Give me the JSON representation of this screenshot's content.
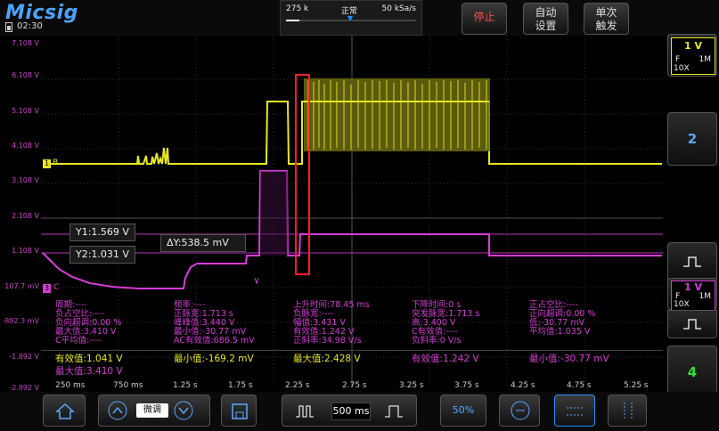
{
  "header": {
    "logo": "Micsig",
    "clock": "02:30",
    "memory_depth": "275 k",
    "trigger_status": "正常",
    "sample_rate": "50 kSa/s",
    "stop_label": "停止",
    "auto_label": [
      "自动",
      "设置"
    ],
    "single_label": [
      "单次",
      "触发"
    ]
  },
  "y_axis_labels": [
    "7.108 V",
    "6.108 V",
    "5.108 V",
    "4.108 V",
    "3.108 V",
    "2.108 V",
    "1.108 V",
    "107.7 mV",
    "-892.3 mV",
    "-1.892 V",
    "-2.892 V"
  ],
  "x_axis_labels": [
    "250 ms",
    "750 ms",
    "1.25 s",
    "1.75 s",
    "2.25 s",
    "2.75 s",
    "3.25 s",
    "3.75 s",
    "4.25 s",
    "4.75 s",
    "5.25 s"
  ],
  "markers": {
    "ch1": "1",
    "ch1_letter": "B",
    "ch3": "3",
    "ch3_letter": "C"
  },
  "cursors": {
    "y1": "Y1:1.569 V",
    "y2": "Y2:1.031 V",
    "dy": "ΔY:538.5 mV"
  },
  "measurements_ch3": {
    "col1": [
      "周期:----",
      "负占空比:----",
      "负向超调:0.00 %",
      "最大值:3.410 V",
      "C平均值:----"
    ],
    "col2": [
      "频率:----",
      "正脉宽:1.713 s",
      "峰峰值:3.440 V",
      "最小值:-30.77 mV",
      "AC有效值:686.5 mV"
    ],
    "col3": [
      "上升时间:78.45 ms",
      "负脉宽:----",
      "幅值:3.431 V",
      "有效值:1.242 V",
      "正斜率:34.98 V/s"
    ],
    "col4": [
      "下降时间:0 s",
      "突发脉宽:1.713 s",
      "高:3.400 V",
      "C有效值:----",
      "负斜率:0 V/s"
    ],
    "col5": [
      "正占空比:----",
      "正向超调:0.00 %",
      "低:-30.77 mV",
      "平均值:1.035 V"
    ]
  },
  "measurements_summary": {
    "yellow": [
      "有效值:1.041 V",
      "最小值:-169.2 mV",
      "最大值:2.428 V"
    ],
    "pink": [
      "有效值:1.242 V",
      "最小值:-30.77 mV"
    ],
    "pink_max": "最大值:3.410 V"
  },
  "right_panel": {
    "ch1_scale": "1 V",
    "ch1_coupling": "F",
    "ch1_imp": "1M",
    "ch1_probe": "10X",
    "ch2_label": "2",
    "ch3_scale": "1 V",
    "ch3_coupling": "F",
    "ch3_imp": "1M",
    "ch3_probe": "10X",
    "ch4_label": "4"
  },
  "bottom": {
    "fine_label": "微调",
    "timebase": "500 ms",
    "percent_label": "50%"
  },
  "colors": {
    "ch1": "#e8e821",
    "ch3": "#d63cd6",
    "accent": "#1e90ff",
    "cursor_box": "#ff2020",
    "ch4_label": "#33dd33",
    "ch2_label": "#5aa9ff"
  }
}
